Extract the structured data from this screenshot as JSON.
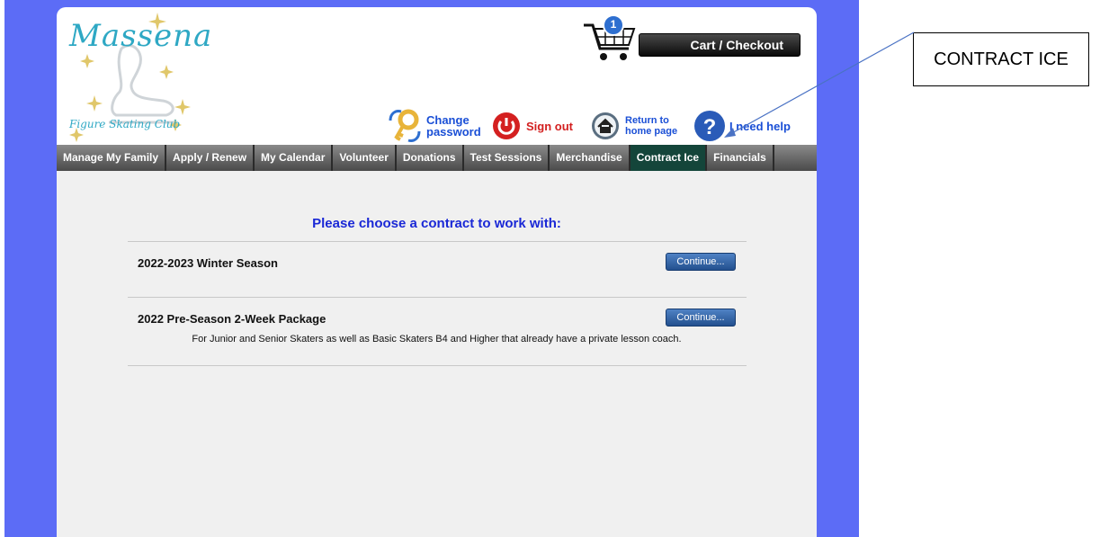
{
  "logo": {
    "title": "Massena",
    "subtitle": "Figure Skating Club"
  },
  "cart": {
    "count": "1",
    "button_label": "Cart / Checkout"
  },
  "utility": {
    "change_password_line1": "Change",
    "change_password_line2": "password",
    "sign_out": "Sign out",
    "return_home_line1": "Return to",
    "return_home_line2": "home page",
    "help": "I need help"
  },
  "nav": {
    "items": [
      {
        "label": "Manage My Family"
      },
      {
        "label": "Apply / Renew"
      },
      {
        "label": "My Calendar"
      },
      {
        "label": "Volunteer"
      },
      {
        "label": "Donations"
      },
      {
        "label": "Test Sessions"
      },
      {
        "label": "Merchandise"
      },
      {
        "label": "Contract Ice",
        "active": true
      },
      {
        "label": "Financials"
      }
    ]
  },
  "main": {
    "heading": "Please choose a contract to work with:",
    "contracts": [
      {
        "name": "2022-2023 Winter Season",
        "button": "Continue...",
        "description": ""
      },
      {
        "name": "2022 Pre-Season 2-Week Package",
        "button": "Continue...",
        "description": "For Junior and Senior Skaters as well as Basic Skaters B4 and Higher that already have a private lesson coach."
      }
    ]
  },
  "annotation": {
    "callout_text": "CONTRACT ICE"
  },
  "colors": {
    "page_background": "#5c6cf6",
    "nav_active": "#14453a",
    "heading": "#1a28d6",
    "button": "#2f62a8"
  }
}
